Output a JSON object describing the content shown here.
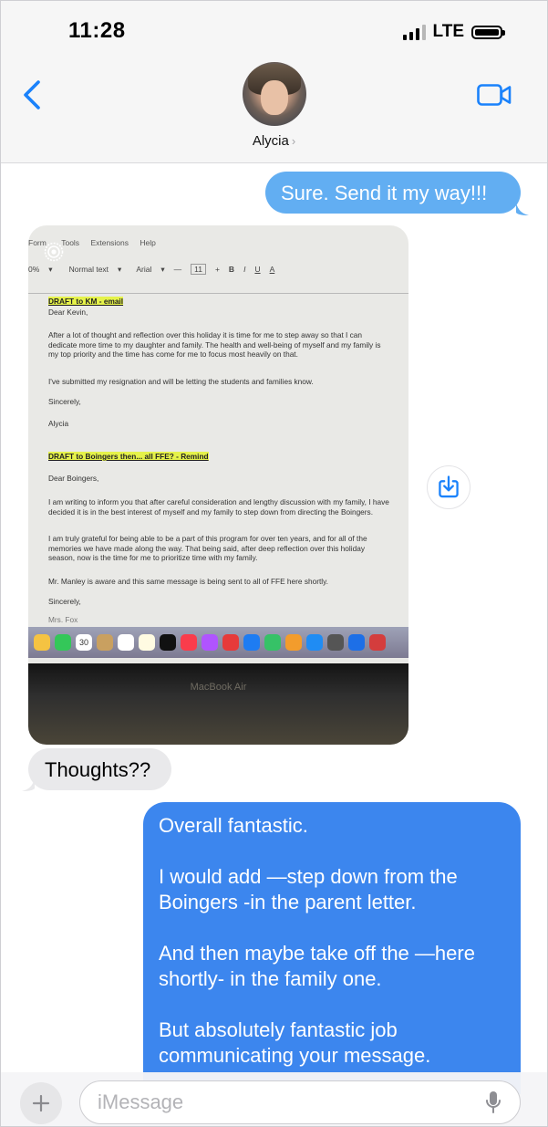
{
  "status_bar": {
    "time": "11:28",
    "network": "LTE"
  },
  "header": {
    "contact_name": "Alycia"
  },
  "messages": {
    "m1": "Sure.  Send it my way!!!",
    "m3": "Thoughts??",
    "m4": {
      "p1": "Overall fantastic.",
      "p2": "I would add —step down from the Boingers -in the parent letter.",
      "p3": "And then maybe take off the —here shortly- in the family one.",
      "p4": "But absolutely fantastic job communicating your message."
    }
  },
  "photo": {
    "menu": [
      "Form",
      "Tools",
      "Extensions",
      "Help"
    ],
    "toolbar": {
      "zoom": "0%",
      "style": "Normal text",
      "font": "Arial",
      "size": "11"
    },
    "doc": {
      "h1": "DRAFT to KM - email",
      "greet1": "Dear Kevin,",
      "para1": "After a lot of thought and reflection over this holiday it is time for me to step away so that I can dedicate more time to my daughter and family. The health and well-being of myself and my family is my top priority and the time has come for me to focus most heavily on that.",
      "para2": "I've submitted my resignation and will be letting the students and families know.",
      "sign1": "Sincerely,",
      "name1": "Alycia",
      "h2": "DRAFT to Boingers then... all FFE? - Remind",
      "greet2": "Dear Boingers,",
      "para3": "I am writing to inform you that after careful consideration and lengthy discussion with my family, I have decided it is in the best interest of myself and my family to step down from directing the Boingers.",
      "para4": "I am truly grateful for being able to be a part of this program for over ten years, and for all of the memories we have made along the way. That being said, after deep reflection over this holiday season, now is the time for me to prioritize time with my family.",
      "para5": "Mr. Manley is aware and this same message is being sent to all of FFE here shortly.",
      "sign2": "Sincerely,",
      "name2": "Mrs. Fox"
    },
    "dock_date": "30",
    "laptop_label": "MacBook Air"
  },
  "input": {
    "placeholder": "iMessage"
  },
  "colors": {
    "sent": "#3c86ee",
    "sent_light": "#62aef2",
    "received": "#e9e9eb",
    "accent": "#1a82fb"
  },
  "icons": [
    "back-chevron-icon",
    "video-camera-icon",
    "live-photo-icon",
    "save-download-icon",
    "plus-icon",
    "microphone-icon"
  ]
}
